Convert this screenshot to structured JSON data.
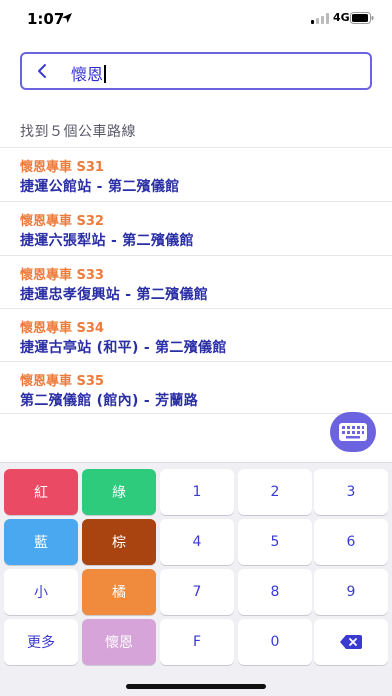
{
  "status_bar": {
    "time": "1:07",
    "network": "4G"
  },
  "search": {
    "query": "懷恩"
  },
  "results": {
    "count_text": "找到５個公車路線",
    "routes": [
      {
        "name": "懷恩專車 S31",
        "desc": "捷運公館站 - 第二殯儀館"
      },
      {
        "name": "懷恩專車 S32",
        "desc": "捷運六張犁站 - 第二殯儀館"
      },
      {
        "name": "懷恩專車 S33",
        "desc": "捷運忠孝復興站 - 第二殯儀館"
      },
      {
        "name": "懷恩專車 S34",
        "desc": "捷運古亭站 (和平) - 第二殯儀館"
      },
      {
        "name": "懷恩專車 S35",
        "desc": "第二殯儀館 (館內) - 芳蘭路"
      }
    ]
  },
  "keypad": {
    "rows": [
      [
        "紅",
        "綠",
        "1",
        "2",
        "3"
      ],
      [
        "藍",
        "棕",
        "4",
        "5",
        "6"
      ],
      [
        "小",
        "橘",
        "7",
        "8",
        "9"
      ],
      [
        "更多",
        "懷恩",
        "F",
        "0",
        "backspace"
      ]
    ]
  },
  "colors": {
    "accent": "#6b63e0",
    "route_name": "#ee7b3b",
    "route_desc": "#2b2fa6",
    "red": "#ea4a63",
    "green": "#2ecb7d",
    "blue": "#4aa8f0",
    "brown": "#a9430f",
    "orange": "#f08a3c",
    "purple": "#d6a4d9"
  },
  "icons": [
    "location-arrow-icon",
    "signal-icon",
    "battery-icon",
    "back-chevron-icon",
    "keyboard-icon",
    "backspace-icon"
  ]
}
